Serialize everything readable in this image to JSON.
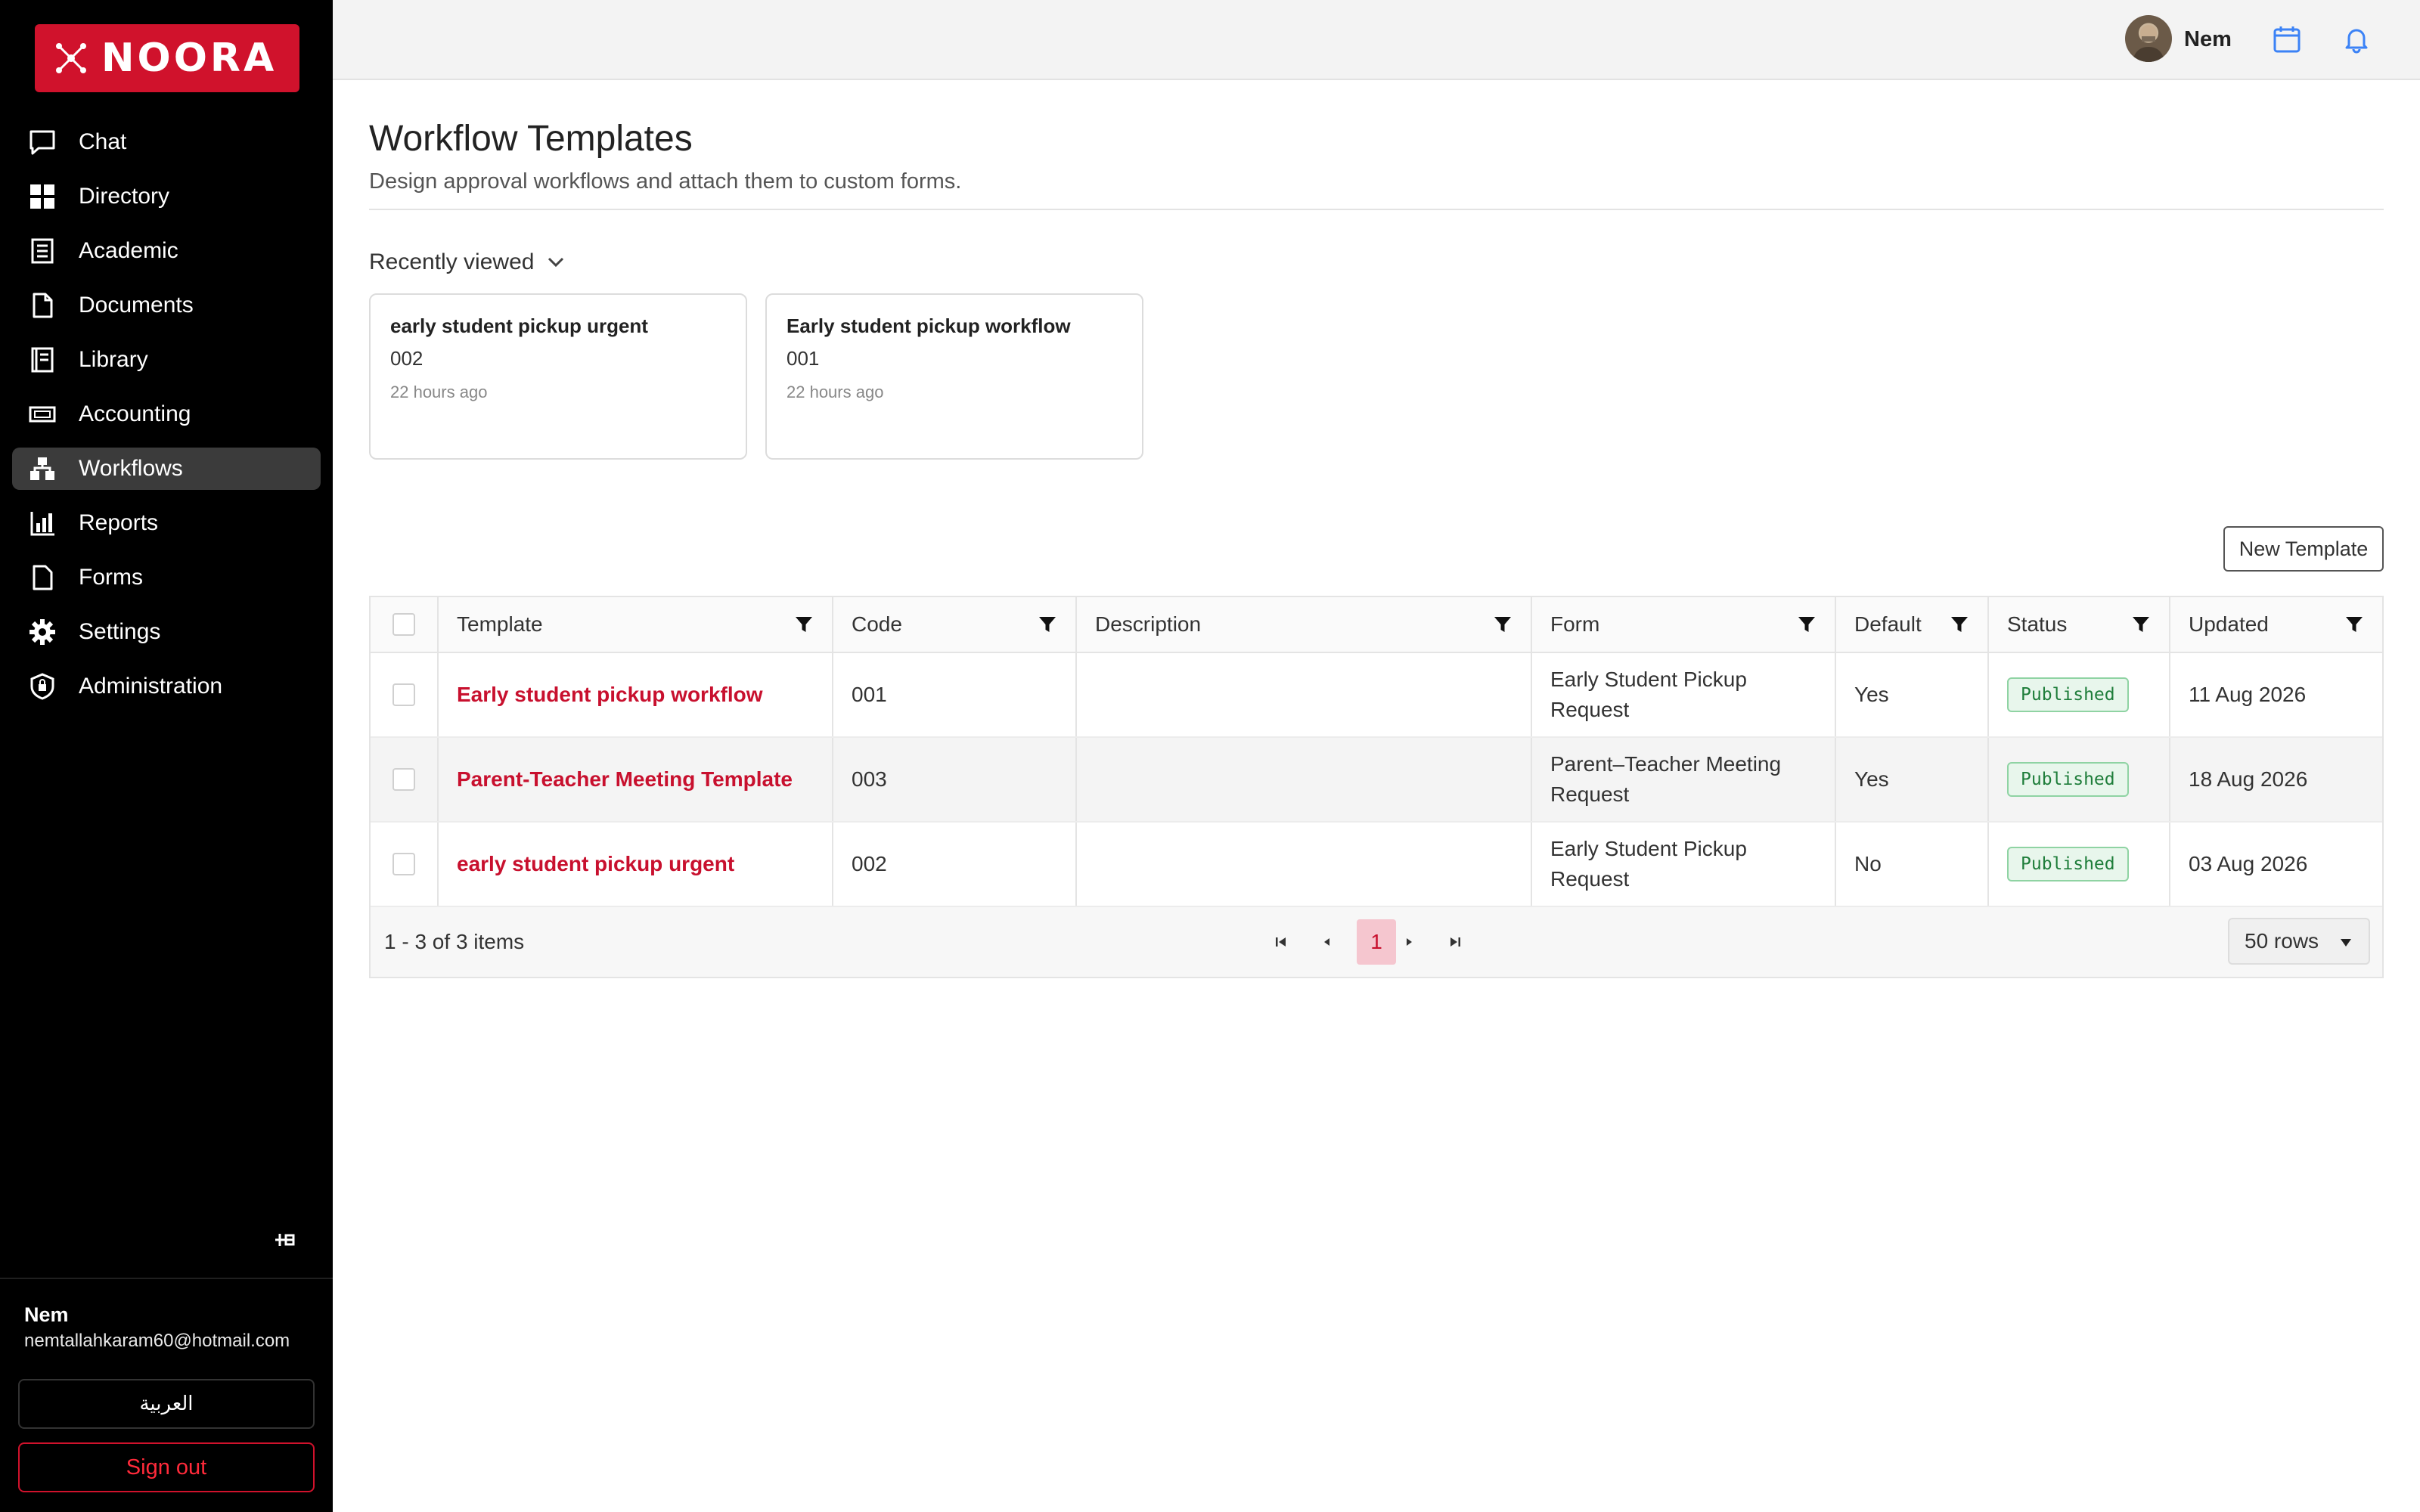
{
  "brand": {
    "name": "NOORA",
    "accent": "#d0122c"
  },
  "sidebar": {
    "items": [
      {
        "label": "Chat",
        "icon": "chat-icon"
      },
      {
        "label": "Directory",
        "icon": "grid-icon"
      },
      {
        "label": "Academic",
        "icon": "book-icon"
      },
      {
        "label": "Documents",
        "icon": "document-icon"
      },
      {
        "label": "Library",
        "icon": "library-icon"
      },
      {
        "label": "Accounting",
        "icon": "money-icon"
      },
      {
        "label": "Workflows",
        "icon": "workflow-icon",
        "active": true
      },
      {
        "label": "Reports",
        "icon": "chart-icon"
      },
      {
        "label": "Forms",
        "icon": "form-icon"
      },
      {
        "label": "Settings",
        "icon": "gear-icon"
      },
      {
        "label": "Administration",
        "icon": "shield-icon"
      }
    ],
    "user": {
      "name": "Nem",
      "email": "nemtallahkaram60@hotmail.com"
    },
    "language_label": "العربية",
    "signout_label": "Sign out"
  },
  "topbar": {
    "user_name": "Nem"
  },
  "main": {
    "title": "Workflow Templates",
    "subtitle": "Design approval workflows and attach them to custom forms.",
    "recent_label": "Recently viewed",
    "recent": [
      {
        "title": "early student pickup urgent",
        "code": "002",
        "time": "22 hours ago"
      },
      {
        "title": "Early student pickup workflow",
        "code": "001",
        "time": "22 hours ago"
      }
    ],
    "new_button_label": "New Template",
    "table": {
      "columns": [
        "Template",
        "Code",
        "Description",
        "Form",
        "Default",
        "Status",
        "Updated"
      ],
      "rows": [
        {
          "template": "Early student pickup workflow",
          "code": "001",
          "description": "",
          "form_line1": "Early Student Pickup",
          "form_line2": "Request",
          "default": "Yes",
          "status": "Published",
          "updated": "11 Aug 2026"
        },
        {
          "template": "Parent-Teacher Meeting Template",
          "code": "003",
          "description": "",
          "form_line1": "Parent–Teacher Meeting",
          "form_line2": "Request",
          "default": "Yes",
          "status": "Published",
          "updated": "18 Aug 2026"
        },
        {
          "template": "early student pickup urgent",
          "code": "002",
          "description": "",
          "form_line1": "Early Student Pickup",
          "form_line2": "Request",
          "default": "No",
          "status": "Published",
          "updated": "03 Aug 2026"
        }
      ]
    },
    "pager": {
      "info": "1 - 3 of 3 items",
      "page": "1",
      "rows_per_page": "50 rows"
    }
  }
}
